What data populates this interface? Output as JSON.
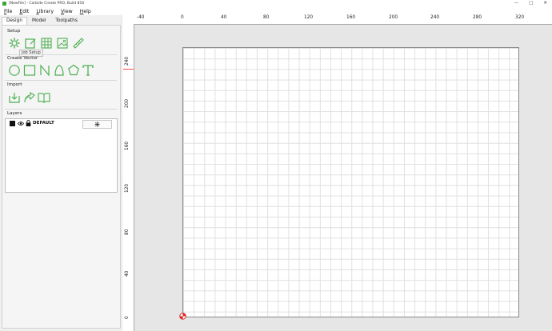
{
  "window": {
    "title": "[NewFile] - Carbide Create PRO, Build 816",
    "accent_color": "#4caf50"
  },
  "menu": [
    "File",
    "Edit",
    "Library",
    "View",
    "Help"
  ],
  "tabs": [
    {
      "label": "Design",
      "active": true
    },
    {
      "label": "Model"
    },
    {
      "label": "Toolpaths"
    }
  ],
  "setup": {
    "label": "Setup",
    "tooltip": "Job Setup",
    "tools": [
      "gear-icon",
      "edit-square-icon",
      "grid-icon",
      "image-icon",
      "ruler-icon"
    ]
  },
  "create_vector": {
    "label": "Create Vector",
    "tools": [
      "circle-icon",
      "rectangle-icon",
      "polyline-icon",
      "curve-icon",
      "polygon-icon",
      "text-icon"
    ]
  },
  "import": {
    "label": "Import",
    "tools": [
      "import-icon",
      "import-vector-icon",
      "book-icon"
    ]
  },
  "layers": {
    "label": "Layers",
    "items": [
      {
        "name": "DEFAULT",
        "visible": true,
        "locked": true,
        "color": "#111111"
      }
    ]
  },
  "rulers": {
    "x_ticks": [
      "-40",
      "0",
      "40",
      "80",
      "120",
      "160",
      "200",
      "240",
      "280",
      "320"
    ],
    "y_ticks": [
      "240",
      "200",
      "160",
      "120",
      "80",
      "40",
      "0"
    ]
  }
}
